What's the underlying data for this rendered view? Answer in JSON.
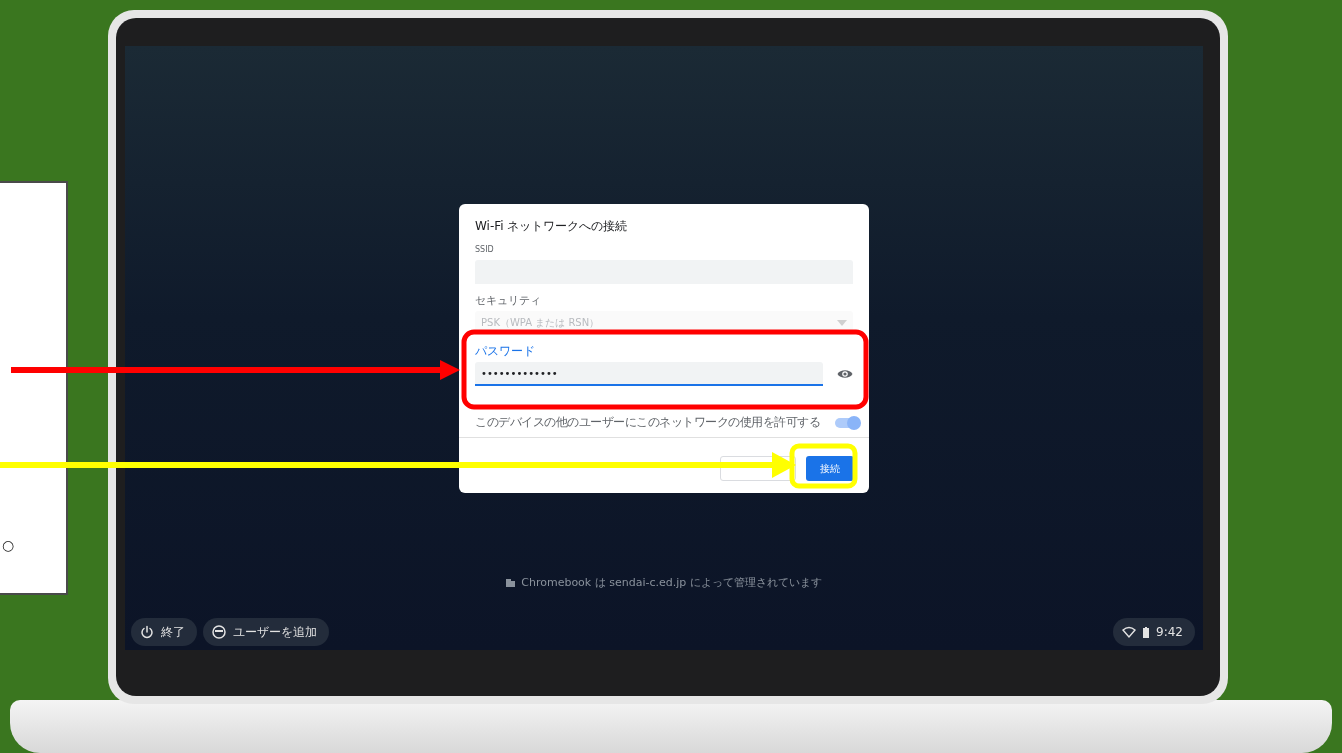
{
  "side_panel": {
    "text": "○"
  },
  "dialog": {
    "title": "Wi-Fi ネットワークへの接続",
    "fields": [
      {
        "kind": "text",
        "label": "SSID"
      },
      {
        "kind": "select",
        "label": "セキュリティ",
        "value": "PSK（WPA または RSN）",
        "disabled": true
      },
      {
        "kind": "password",
        "label": "パスワード",
        "value": "•••••••••••••",
        "focused": true
      }
    ],
    "toggle": {
      "label": "このデバイスの他のユーザーにこのネットワークの使用を許可する",
      "on": true
    },
    "buttons": [
      {
        "kind": "outlined"
      },
      {
        "kind": "primary",
        "label": "接続"
      }
    ]
  },
  "managed_note": "Chromebook は sendai-c.ed.jp によって管理されています",
  "shelf": {
    "buttons": [
      {
        "kind": "power",
        "label": "終了"
      },
      {
        "kind": "add-user",
        "label": "ユーザーを追加"
      }
    ],
    "time": "9:42"
  },
  "annotations": [
    {
      "kind": "highlight-arrow",
      "color": "#ff0000"
    },
    {
      "kind": "highlight-arrow",
      "color": "#ffff00"
    }
  ]
}
